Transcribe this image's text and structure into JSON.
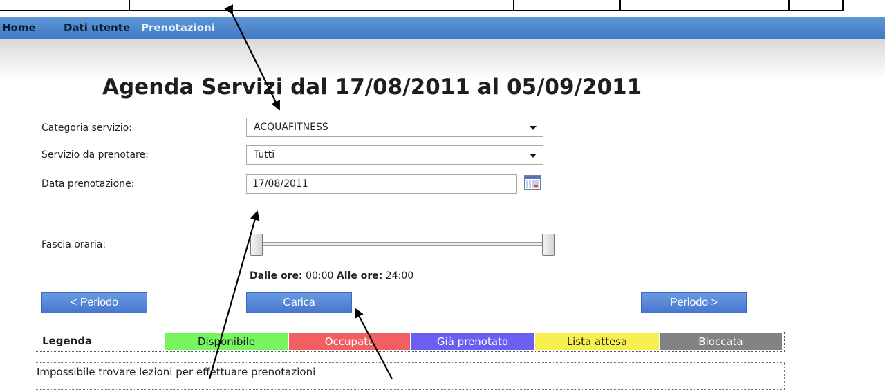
{
  "nav": {
    "home": "Home",
    "user_data": "Dati utente",
    "bookings": "Prenotazioni"
  },
  "page": {
    "title": "Agenda Servizi dal 17/08/2011 al 05/09/2011"
  },
  "form": {
    "category_label": "Categoria servizio:",
    "category_value": "ACQUAFITNESS",
    "service_label": "Servizio da prenotare:",
    "service_value": "Tutti",
    "date_label": "Data prenotazione:",
    "date_value": "17/08/2011",
    "time_band_label": "Fascia oraria:",
    "from_label": "Dalle ore:",
    "from_value": "00:00",
    "to_label": "Alle ore:",
    "to_value": "24:00"
  },
  "slider": {
    "min_hour": 0,
    "max_hour": 24
  },
  "buttons": {
    "prev_period": "< Periodo",
    "load": "Carica",
    "next_period": "Periodo >"
  },
  "legend": {
    "title": "Legenda",
    "items": [
      {
        "label": "Disponibile",
        "color": "#76f55f"
      },
      {
        "label": "Occupato",
        "color": "#f25f63"
      },
      {
        "label": "Già prenotato",
        "color": "#6b5ff1"
      },
      {
        "label": "Lista attesa",
        "color": "#f7ee4f"
      },
      {
        "label": "Bloccata",
        "color": "#828282"
      }
    ]
  },
  "message": {
    "text": "Impossibile trovare lezioni per effettuare prenotazioni"
  },
  "icons": {
    "calendar": "calendar-icon",
    "dropdown": "chevron-down-icon"
  }
}
